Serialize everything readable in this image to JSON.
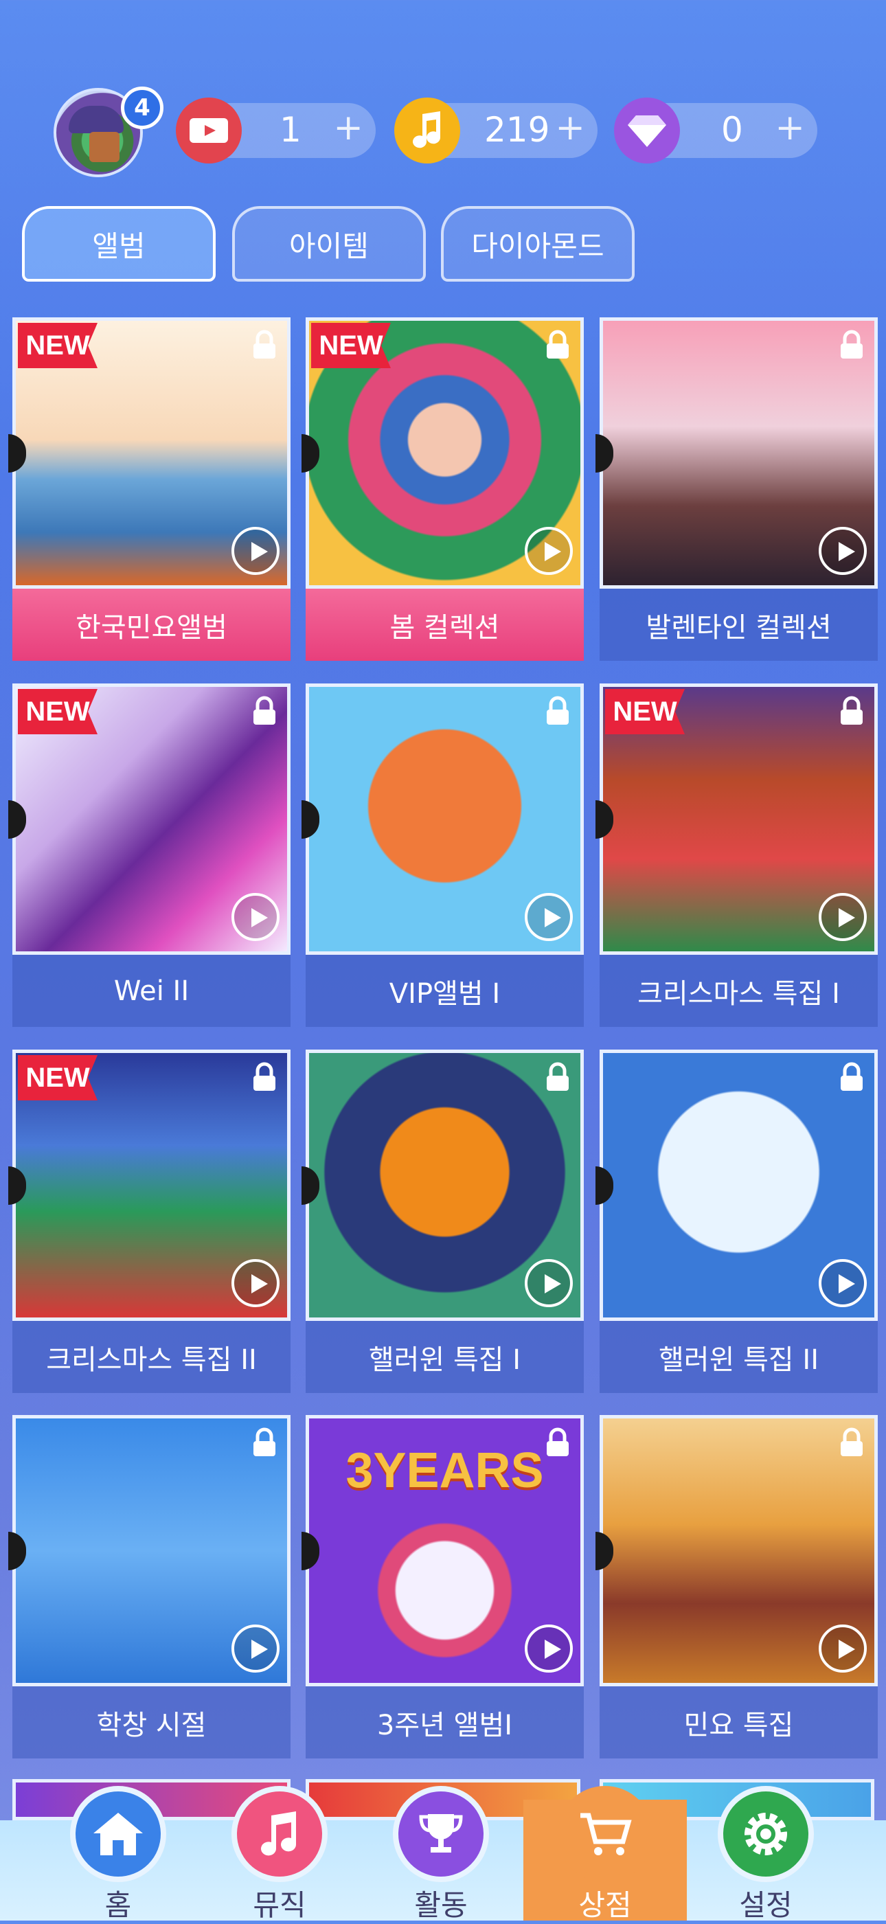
{
  "resources": {
    "notification_count": "4",
    "tickets": {
      "value": "1",
      "plus": "+"
    },
    "notes": {
      "value": "219",
      "plus": "+"
    },
    "diamonds": {
      "value": "0",
      "plus": "+"
    }
  },
  "tabs": [
    {
      "label": "앨범",
      "active": true
    },
    {
      "label": "아이템",
      "active": false
    },
    {
      "label": "다이아몬드",
      "active": false
    }
  ],
  "new_tag": "NEW",
  "albums": [
    {
      "title": "한국민요앨범",
      "new": true,
      "highlight": "pink",
      "icon": "hanbok-dancer-art"
    },
    {
      "title": "봄 컬렉션",
      "new": true,
      "highlight": "pink",
      "icon": "flower-woman-art"
    },
    {
      "title": "발렌타인 컬렉션",
      "new": false,
      "icon": "valentine-guitar-art"
    },
    {
      "title": "Wei II",
      "new": true,
      "icon": "ink-splash-art"
    },
    {
      "title": "VIP앨범 I",
      "new": false,
      "icon": "crown-badge-art"
    },
    {
      "title": "크리스마스 특집 I",
      "new": true,
      "icon": "santa-art"
    },
    {
      "title": "크리스마스 특집 II",
      "new": true,
      "icon": "santa-tree-art"
    },
    {
      "title": "핼러윈 특집 I",
      "new": false,
      "icon": "pumpkin-art"
    },
    {
      "title": "핼러윈 특집 II",
      "new": false,
      "icon": "moon-silhouette-art"
    },
    {
      "title": "학창 시절",
      "new": false,
      "icon": "jumping-kids-art"
    },
    {
      "title": "3주년 앨범I",
      "new": false,
      "icon": "anniversary-cake-art",
      "art_text": "3YEARS"
    },
    {
      "title": "민요 특집",
      "new": false,
      "icon": "guitarist-art"
    }
  ],
  "bottom_nav": [
    {
      "label": "홈",
      "icon": "home-icon",
      "color": "#3a82e8"
    },
    {
      "label": "뮤직",
      "icon": "music-note-icon",
      "color": "#f0547f"
    },
    {
      "label": "활동",
      "icon": "trophy-icon",
      "color": "#8a4fe0"
    },
    {
      "label": "상점",
      "icon": "cart-icon",
      "color": "#f39a4a",
      "active": true
    },
    {
      "label": "설정",
      "icon": "gear-icon",
      "color": "#2fa84f"
    }
  ]
}
